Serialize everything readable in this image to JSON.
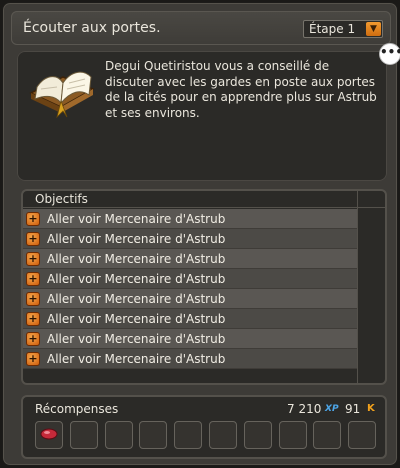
{
  "window": {
    "title": "Écouter aux portes.",
    "stage_select": {
      "selected": "Étape 1",
      "arrow_icon": "chevron-down-icon"
    }
  },
  "description": {
    "icon": "quest-book-icon",
    "text": "Degui Quetiristou vous a conseillé de discuter avec les gardes en poste aux portes de la cités pour en apprendre plus sur Astrub et ses environs.",
    "chat_icon": "speech-bubble-icon",
    "chat_symbol": "•••"
  },
  "objectives": {
    "header": "Objectifs",
    "item_icon": "add-circle-icon",
    "item_symbol": "+",
    "items": [
      {
        "label": "Aller voir Mercenaire d'Astrub"
      },
      {
        "label": "Aller voir Mercenaire d'Astrub"
      },
      {
        "label": "Aller voir Mercenaire d'Astrub"
      },
      {
        "label": "Aller voir Mercenaire d'Astrub"
      },
      {
        "label": "Aller voir Mercenaire d'Astrub"
      },
      {
        "label": "Aller voir Mercenaire d'Astrub"
      },
      {
        "label": "Aller voir Mercenaire d'Astrub"
      },
      {
        "label": "Aller voir Mercenaire d'Astrub"
      }
    ]
  },
  "rewards": {
    "label": "Récompenses",
    "xp_value": "7 210",
    "xp_unit": "XP",
    "kamas_value": "91",
    "kamas_symbol": "K",
    "slots": [
      {
        "item": "meat-ration-icon"
      },
      {
        "item": ""
      },
      {
        "item": ""
      },
      {
        "item": ""
      },
      {
        "item": ""
      },
      {
        "item": ""
      },
      {
        "item": ""
      },
      {
        "item": ""
      },
      {
        "item": ""
      },
      {
        "item": ""
      }
    ]
  },
  "colors": {
    "accent_orange": "#f29a2f",
    "xp_blue": "#4da6e8",
    "kamas_gold": "#f2a21c"
  }
}
